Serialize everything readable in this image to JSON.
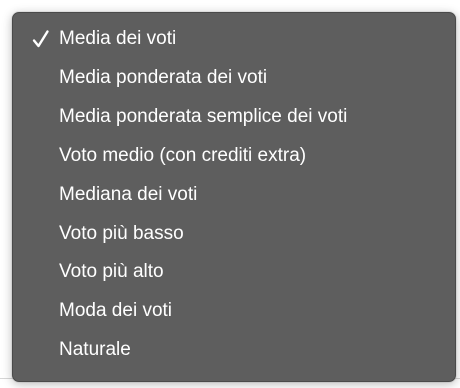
{
  "menu": {
    "selected_index": 0,
    "items": [
      {
        "label": "Media dei voti",
        "checked": true
      },
      {
        "label": "Media ponderata dei voti",
        "checked": false
      },
      {
        "label": "Media ponderata semplice dei voti",
        "checked": false
      },
      {
        "label": "Voto medio (con crediti extra)",
        "checked": false
      },
      {
        "label": "Mediana dei voti",
        "checked": false
      },
      {
        "label": "Voto più basso",
        "checked": false
      },
      {
        "label": "Voto più alto",
        "checked": false
      },
      {
        "label": "Moda dei voti",
        "checked": false
      },
      {
        "label": "Naturale",
        "checked": false
      }
    ]
  },
  "colors": {
    "menu_background": "#5e5e5e",
    "item_text": "#ffffff",
    "checkmark": "#ffffff"
  },
  "icons": {
    "selected_marker": "checkmark-icon"
  }
}
